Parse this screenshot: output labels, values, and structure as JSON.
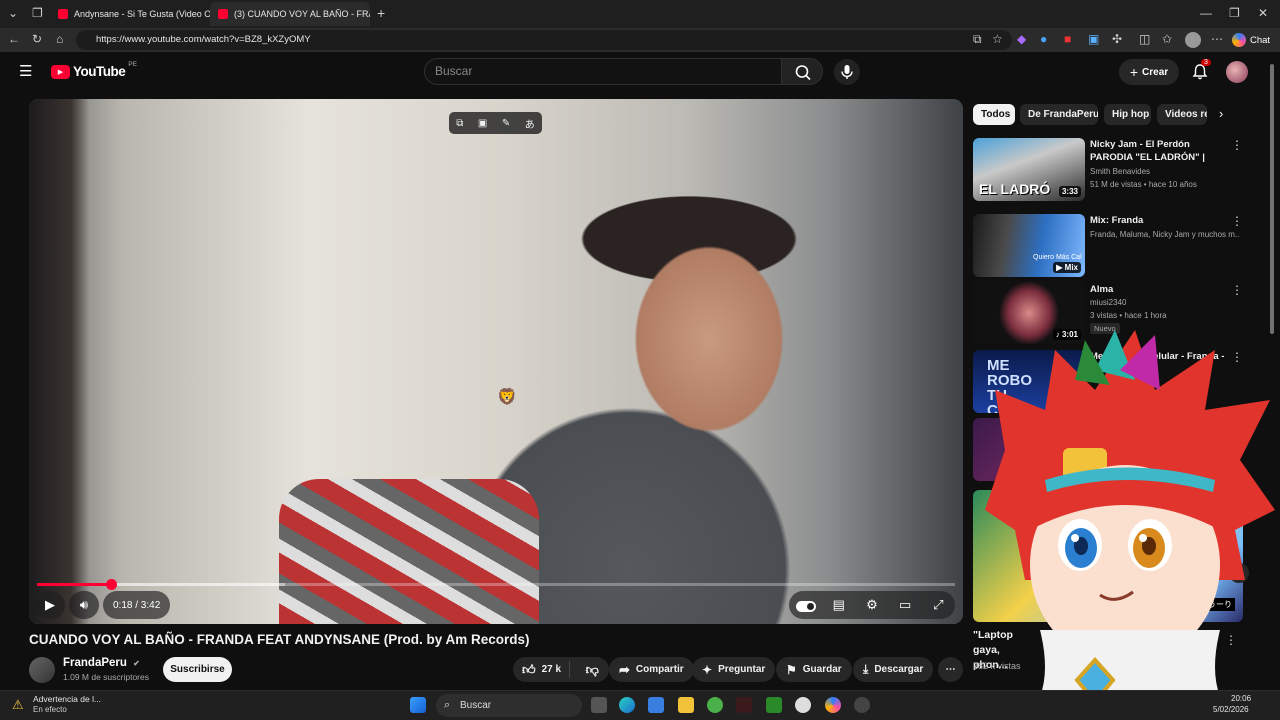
{
  "browser": {
    "tabs": [
      {
        "title": "Andynsane - Si Te Gusta (Video Of"
      },
      {
        "title": "(3) CUANDO VOY AL BAÑO - FRAN"
      }
    ],
    "url": "https://www.youtube.com/watch?v=BZ8_kXZyOMY",
    "copilot_label": "Chat"
  },
  "header": {
    "logo_text": "YouTube",
    "region": "PE",
    "search_placeholder": "Buscar",
    "create_label": "Crear",
    "notification_count": "3"
  },
  "player": {
    "current_time": "0:18",
    "duration": "3:42",
    "time_display": "0:18 / 3:42",
    "progress": 0.081,
    "buffered": 0.27
  },
  "video": {
    "title": "CUANDO VOY AL BAÑO - FRANDA FEAT ANDYNSANE (Prod. by Am Records)",
    "channel": "FrandaPeru",
    "subscribers": "1.09 M de suscriptores",
    "subscribe_label": "Suscribirse",
    "likes": "27 k",
    "share_label": "Compartir",
    "ask_label": "Preguntar",
    "save_label": "Guardar",
    "download_label": "Descargar"
  },
  "sidebar": {
    "chips": [
      "Todos",
      "De FrandaPeru",
      "Hip hop",
      "Videos re"
    ],
    "recommendations": [
      {
        "title": "Nicky Jam - El Perdón PARODIA \"EL LADRÓN\" | Smith Benavides",
        "channel": "Smith Benavides",
        "meta": "51 M de vistas • hace 10 años",
        "duration": "3:33",
        "thumb_text": "EL LADRÓ"
      },
      {
        "title": "Mix: Franda",
        "channel": "Franda, Maluma, Nicky Jam y muchos m...",
        "meta": "",
        "duration": "Mix",
        "thumb_text": "Quiero Más Cal"
      },
      {
        "title": "Alma",
        "channel": "miusi2340",
        "meta": "3 vistas • hace 1 hora",
        "duration": "3:01",
        "badge": "Nuevo"
      },
      {
        "title": "Me Robo Tu Celular - Franda -",
        "channel": "",
        "meta": "",
        "duration": "",
        "thumb_text": "ME ROBO TU CELUL"
      }
    ],
    "bottom_card": {
      "title": "\"Laptop gaya, phon...",
      "meta": "282 k vistas",
      "thumb_text": "十五分とうーり"
    }
  },
  "taskbar": {
    "weather_title": "Advertencia de l...",
    "weather_sub": "En efecto",
    "search_label": "Buscar",
    "time": "20:06",
    "date": "5/02/2026"
  }
}
